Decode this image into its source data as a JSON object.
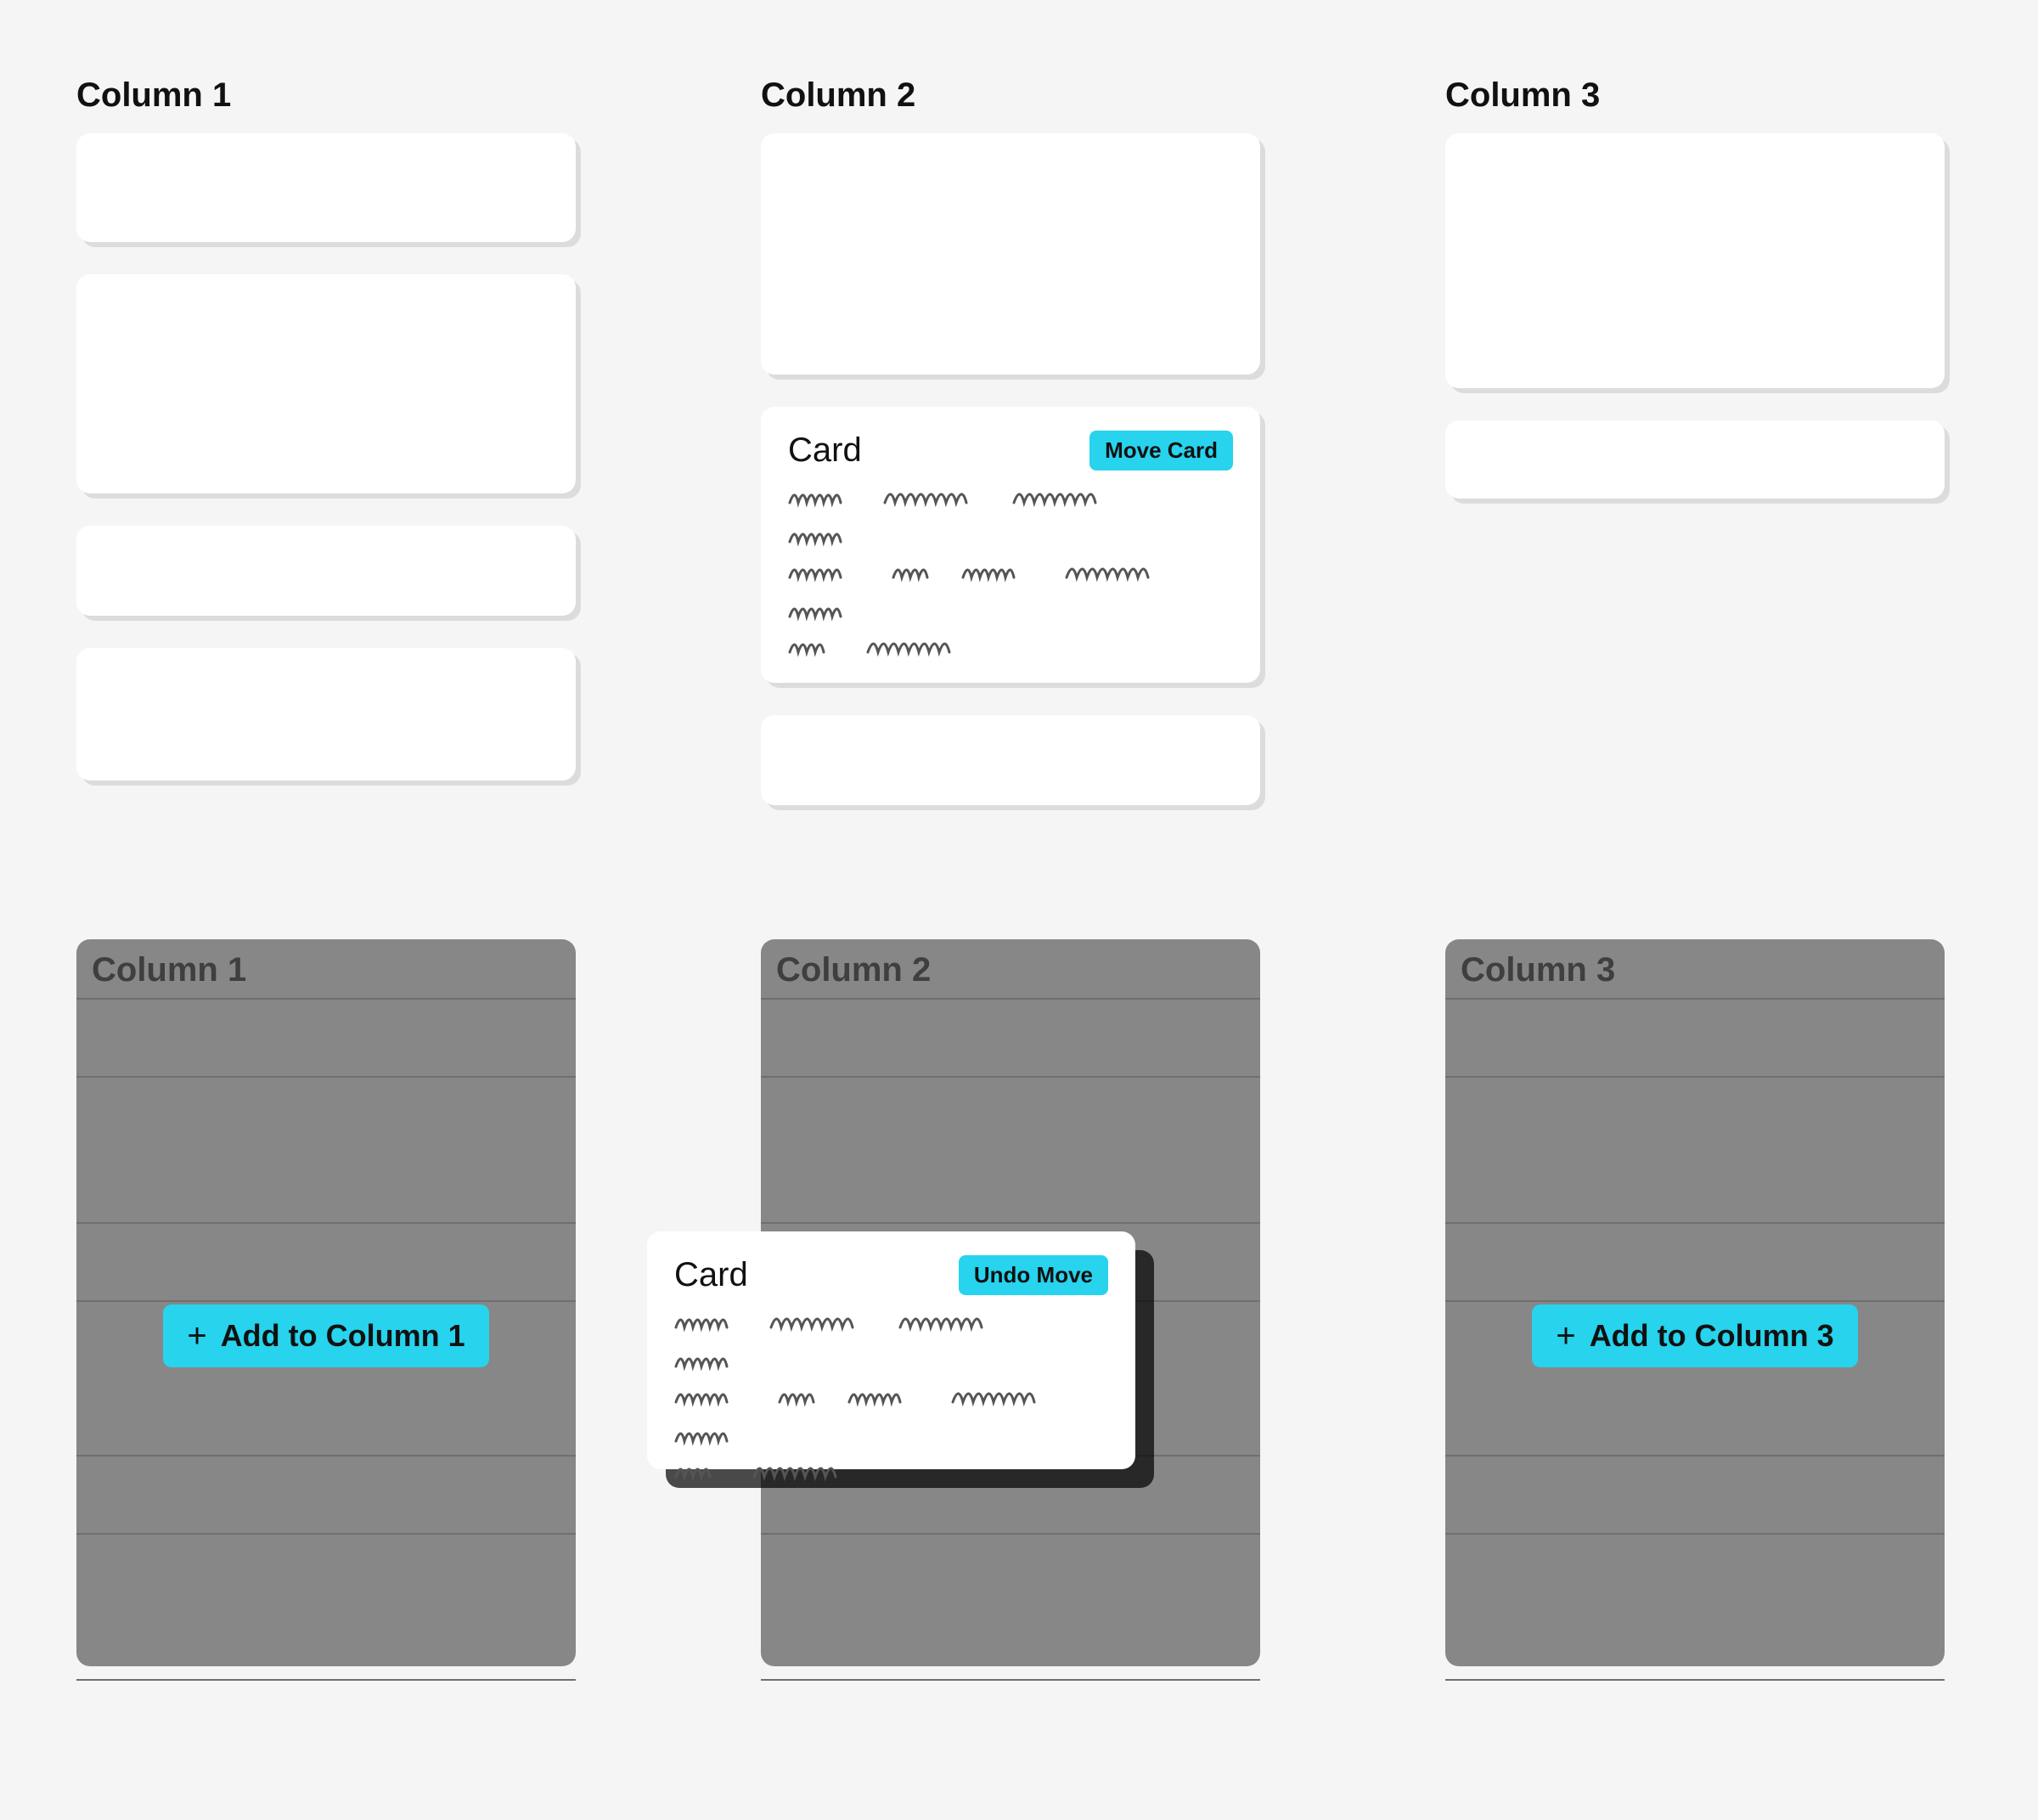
{
  "top": {
    "columns": [
      {
        "title": "Column 1"
      },
      {
        "title": "Column 2"
      },
      {
        "title": "Column 3"
      }
    ],
    "featured_card": {
      "title": "Card",
      "button": "Move Card"
    }
  },
  "bottom": {
    "columns": [
      {
        "title": "Column 1",
        "add_label": "Add to Column 1"
      },
      {
        "title": "Column 2"
      },
      {
        "title": "Column 3",
        "add_label": "Add to Column 3"
      }
    ],
    "floating_card": {
      "title": "Card",
      "button": "Undo Move"
    }
  }
}
